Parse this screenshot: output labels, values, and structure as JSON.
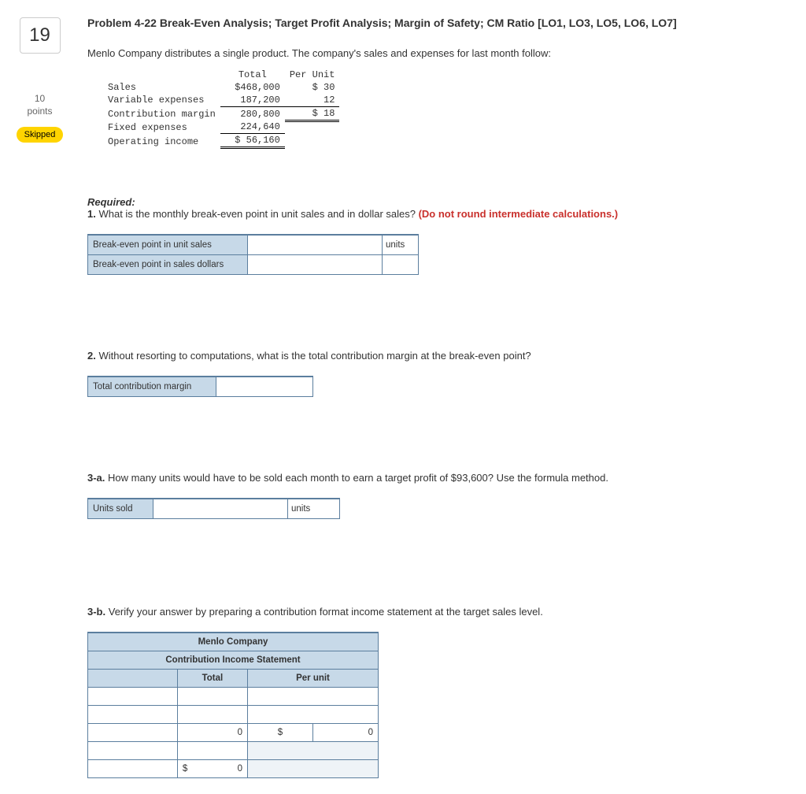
{
  "left": {
    "qnum": "19",
    "points_num": "10",
    "points_lbl": "points",
    "skipped": "Skipped"
  },
  "title": "Problem 4-22 Break-Even Analysis; Target Profit Analysis; Margin of Safety; CM Ratio [LO1, LO3, LO5, LO6, LO7]",
  "intro": "Menlo Company distributes a single product. The company's sales and expenses for last month follow:",
  "inc": {
    "col_total": "Total",
    "col_pu": "Per Unit",
    "r_sales": "Sales",
    "v_sales": "$468,000",
    "pu_sales": "$ 30",
    "r_varex": "Variable expenses",
    "v_varex": "187,200",
    "pu_varex": "12",
    "r_cm": "Contribution margin",
    "v_cm": "280,800",
    "pu_cm": "$ 18",
    "r_fixed": "Fixed expenses",
    "v_fixed": "224,640",
    "r_oi": "Operating income",
    "v_oi": "$ 56,160"
  },
  "req_hdr": "Required:",
  "q1": {
    "num": "1.",
    "text": " What is the monthly break-even point in unit sales and in dollar sales? ",
    "warn": "(Do not round intermediate calculations.)",
    "row1": "Break-even point in unit sales",
    "row2": "Break-even point in sales dollars",
    "unit": "units"
  },
  "q2": {
    "num": "2.",
    "text": " Without resorting to computations, what is the total contribution margin at the break-even point?",
    "row": "Total contribution margin"
  },
  "q3a": {
    "num": "3-a.",
    "text": " How many units would have to be sold each month to earn a target profit of $93,600? Use the formula method.",
    "row": "Units sold",
    "unit": "units"
  },
  "q3b": {
    "num": "3-b.",
    "text": " Verify your answer by preparing a contribution format income statement at the target sales level.",
    "h1": "Menlo Company",
    "h2": "Contribution Income Statement",
    "col_total": "Total",
    "col_pu": "Per unit",
    "zero": "0",
    "dollar": "$"
  }
}
